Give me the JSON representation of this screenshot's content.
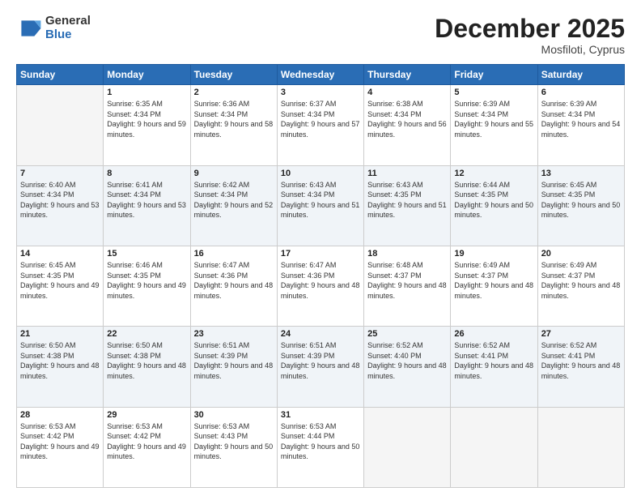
{
  "header": {
    "logo_general": "General",
    "logo_blue": "Blue",
    "month_title": "December 2025",
    "location": "Mosfiloti, Cyprus"
  },
  "days_of_week": [
    "Sunday",
    "Monday",
    "Tuesday",
    "Wednesday",
    "Thursday",
    "Friday",
    "Saturday"
  ],
  "weeks": [
    [
      {
        "day": "",
        "sunrise": "",
        "sunset": "",
        "daylight": "",
        "empty": true
      },
      {
        "day": "1",
        "sunrise": "Sunrise: 6:35 AM",
        "sunset": "Sunset: 4:34 PM",
        "daylight": "Daylight: 9 hours and 59 minutes."
      },
      {
        "day": "2",
        "sunrise": "Sunrise: 6:36 AM",
        "sunset": "Sunset: 4:34 PM",
        "daylight": "Daylight: 9 hours and 58 minutes."
      },
      {
        "day": "3",
        "sunrise": "Sunrise: 6:37 AM",
        "sunset": "Sunset: 4:34 PM",
        "daylight": "Daylight: 9 hours and 57 minutes."
      },
      {
        "day": "4",
        "sunrise": "Sunrise: 6:38 AM",
        "sunset": "Sunset: 4:34 PM",
        "daylight": "Daylight: 9 hours and 56 minutes."
      },
      {
        "day": "5",
        "sunrise": "Sunrise: 6:39 AM",
        "sunset": "Sunset: 4:34 PM",
        "daylight": "Daylight: 9 hours and 55 minutes."
      },
      {
        "day": "6",
        "sunrise": "Sunrise: 6:39 AM",
        "sunset": "Sunset: 4:34 PM",
        "daylight": "Daylight: 9 hours and 54 minutes."
      }
    ],
    [
      {
        "day": "7",
        "sunrise": "Sunrise: 6:40 AM",
        "sunset": "Sunset: 4:34 PM",
        "daylight": "Daylight: 9 hours and 53 minutes."
      },
      {
        "day": "8",
        "sunrise": "Sunrise: 6:41 AM",
        "sunset": "Sunset: 4:34 PM",
        "daylight": "Daylight: 9 hours and 53 minutes."
      },
      {
        "day": "9",
        "sunrise": "Sunrise: 6:42 AM",
        "sunset": "Sunset: 4:34 PM",
        "daylight": "Daylight: 9 hours and 52 minutes."
      },
      {
        "day": "10",
        "sunrise": "Sunrise: 6:43 AM",
        "sunset": "Sunset: 4:34 PM",
        "daylight": "Daylight: 9 hours and 51 minutes."
      },
      {
        "day": "11",
        "sunrise": "Sunrise: 6:43 AM",
        "sunset": "Sunset: 4:35 PM",
        "daylight": "Daylight: 9 hours and 51 minutes."
      },
      {
        "day": "12",
        "sunrise": "Sunrise: 6:44 AM",
        "sunset": "Sunset: 4:35 PM",
        "daylight": "Daylight: 9 hours and 50 minutes."
      },
      {
        "day": "13",
        "sunrise": "Sunrise: 6:45 AM",
        "sunset": "Sunset: 4:35 PM",
        "daylight": "Daylight: 9 hours and 50 minutes."
      }
    ],
    [
      {
        "day": "14",
        "sunrise": "Sunrise: 6:45 AM",
        "sunset": "Sunset: 4:35 PM",
        "daylight": "Daylight: 9 hours and 49 minutes."
      },
      {
        "day": "15",
        "sunrise": "Sunrise: 6:46 AM",
        "sunset": "Sunset: 4:35 PM",
        "daylight": "Daylight: 9 hours and 49 minutes."
      },
      {
        "day": "16",
        "sunrise": "Sunrise: 6:47 AM",
        "sunset": "Sunset: 4:36 PM",
        "daylight": "Daylight: 9 hours and 48 minutes."
      },
      {
        "day": "17",
        "sunrise": "Sunrise: 6:47 AM",
        "sunset": "Sunset: 4:36 PM",
        "daylight": "Daylight: 9 hours and 48 minutes."
      },
      {
        "day": "18",
        "sunrise": "Sunrise: 6:48 AM",
        "sunset": "Sunset: 4:37 PM",
        "daylight": "Daylight: 9 hours and 48 minutes."
      },
      {
        "day": "19",
        "sunrise": "Sunrise: 6:49 AM",
        "sunset": "Sunset: 4:37 PM",
        "daylight": "Daylight: 9 hours and 48 minutes."
      },
      {
        "day": "20",
        "sunrise": "Sunrise: 6:49 AM",
        "sunset": "Sunset: 4:37 PM",
        "daylight": "Daylight: 9 hours and 48 minutes."
      }
    ],
    [
      {
        "day": "21",
        "sunrise": "Sunrise: 6:50 AM",
        "sunset": "Sunset: 4:38 PM",
        "daylight": "Daylight: 9 hours and 48 minutes."
      },
      {
        "day": "22",
        "sunrise": "Sunrise: 6:50 AM",
        "sunset": "Sunset: 4:38 PM",
        "daylight": "Daylight: 9 hours and 48 minutes."
      },
      {
        "day": "23",
        "sunrise": "Sunrise: 6:51 AM",
        "sunset": "Sunset: 4:39 PM",
        "daylight": "Daylight: 9 hours and 48 minutes."
      },
      {
        "day": "24",
        "sunrise": "Sunrise: 6:51 AM",
        "sunset": "Sunset: 4:39 PM",
        "daylight": "Daylight: 9 hours and 48 minutes."
      },
      {
        "day": "25",
        "sunrise": "Sunrise: 6:52 AM",
        "sunset": "Sunset: 4:40 PM",
        "daylight": "Daylight: 9 hours and 48 minutes."
      },
      {
        "day": "26",
        "sunrise": "Sunrise: 6:52 AM",
        "sunset": "Sunset: 4:41 PM",
        "daylight": "Daylight: 9 hours and 48 minutes."
      },
      {
        "day": "27",
        "sunrise": "Sunrise: 6:52 AM",
        "sunset": "Sunset: 4:41 PM",
        "daylight": "Daylight: 9 hours and 48 minutes."
      }
    ],
    [
      {
        "day": "28",
        "sunrise": "Sunrise: 6:53 AM",
        "sunset": "Sunset: 4:42 PM",
        "daylight": "Daylight: 9 hours and 49 minutes."
      },
      {
        "day": "29",
        "sunrise": "Sunrise: 6:53 AM",
        "sunset": "Sunset: 4:42 PM",
        "daylight": "Daylight: 9 hours and 49 minutes."
      },
      {
        "day": "30",
        "sunrise": "Sunrise: 6:53 AM",
        "sunset": "Sunset: 4:43 PM",
        "daylight": "Daylight: 9 hours and 50 minutes."
      },
      {
        "day": "31",
        "sunrise": "Sunrise: 6:53 AM",
        "sunset": "Sunset: 4:44 PM",
        "daylight": "Daylight: 9 hours and 50 minutes."
      },
      {
        "day": "",
        "sunrise": "",
        "sunset": "",
        "daylight": "",
        "empty": true
      },
      {
        "day": "",
        "sunrise": "",
        "sunset": "",
        "daylight": "",
        "empty": true
      },
      {
        "day": "",
        "sunrise": "",
        "sunset": "",
        "daylight": "",
        "empty": true
      }
    ]
  ]
}
